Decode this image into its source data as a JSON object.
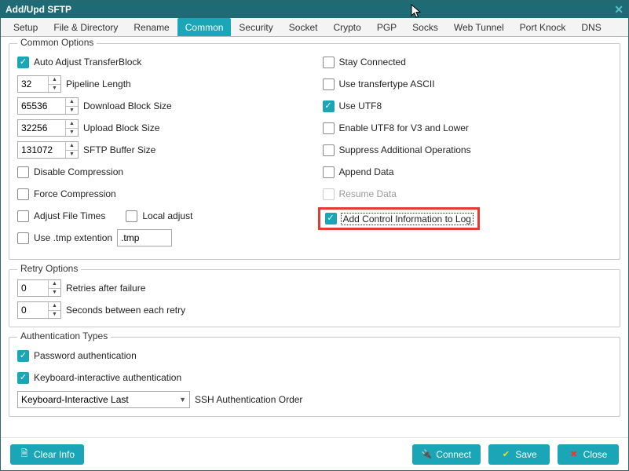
{
  "window": {
    "title": "Add/Upd SFTP"
  },
  "tabs": [
    {
      "label": "Setup",
      "active": false
    },
    {
      "label": "File & Directory",
      "active": false
    },
    {
      "label": "Rename",
      "active": false
    },
    {
      "label": "Common",
      "active": true
    },
    {
      "label": "Security",
      "active": false
    },
    {
      "label": "Socket",
      "active": false
    },
    {
      "label": "Crypto",
      "active": false
    },
    {
      "label": "PGP",
      "active": false
    },
    {
      "label": "Socks",
      "active": false
    },
    {
      "label": "Web Tunnel",
      "active": false
    },
    {
      "label": "Port Knock",
      "active": false
    },
    {
      "label": "DNS",
      "active": false
    }
  ],
  "groups": {
    "common": {
      "title": "Common Options"
    },
    "retry": {
      "title": "Retry Options"
    },
    "auth": {
      "title": "Authentication Types"
    }
  },
  "common": {
    "auto_adjust_transfer_block": {
      "label": "Auto Adjust TransferBlock",
      "checked": true
    },
    "pipeline_length": {
      "value": "32",
      "label": "Pipeline Length"
    },
    "download_block_size": {
      "value": "65536",
      "label": "Download Block Size"
    },
    "upload_block_size": {
      "value": "32256",
      "label": "Upload Block Size"
    },
    "sftp_buffer_size": {
      "value": "131072",
      "label": "SFTP Buffer Size"
    },
    "disable_compression": {
      "label": "Disable Compression",
      "checked": false
    },
    "force_compression": {
      "label": "Force Compression",
      "checked": false
    },
    "adjust_file_times": {
      "label": "Adjust File Times",
      "checked": false
    },
    "local_adjust": {
      "label": "Local adjust",
      "checked": false
    },
    "use_tmp_ext": {
      "label": "Use .tmp extention",
      "checked": false
    },
    "tmp_ext_value": ".tmp",
    "stay_connected": {
      "label": "Stay Connected",
      "checked": false
    },
    "use_transfertype_ascii": {
      "label": "Use transfertype ASCII",
      "checked": false
    },
    "use_utf8": {
      "label": "Use UTF8",
      "checked": true
    },
    "enable_utf8_v3": {
      "label": "Enable UTF8 for V3 and Lower",
      "checked": false
    },
    "suppress_additional": {
      "label": "Suppress Additional Operations",
      "checked": false
    },
    "append_data": {
      "label": "Append Data",
      "checked": false
    },
    "resume_data": {
      "label": "Resume Data",
      "checked": false,
      "disabled": true
    },
    "add_control_info": {
      "label": "Add Control Information to Log",
      "checked": true
    }
  },
  "retry": {
    "retries_after_failure": {
      "value": "0",
      "label": "Retries after failure"
    },
    "seconds_between_each_retry": {
      "value": "0",
      "label": "Seconds between each retry"
    }
  },
  "auth": {
    "password_auth": {
      "label": "Password authentication",
      "checked": true
    },
    "keyboard_auth": {
      "label": "Keyboard-interactive authentication",
      "checked": true
    },
    "order": {
      "value": "Keyboard-Interactive Last",
      "label": "SSH Authentication Order"
    }
  },
  "buttons": {
    "clear_info": "Clear Info",
    "connect": "Connect",
    "save": "Save",
    "close": "Close"
  }
}
